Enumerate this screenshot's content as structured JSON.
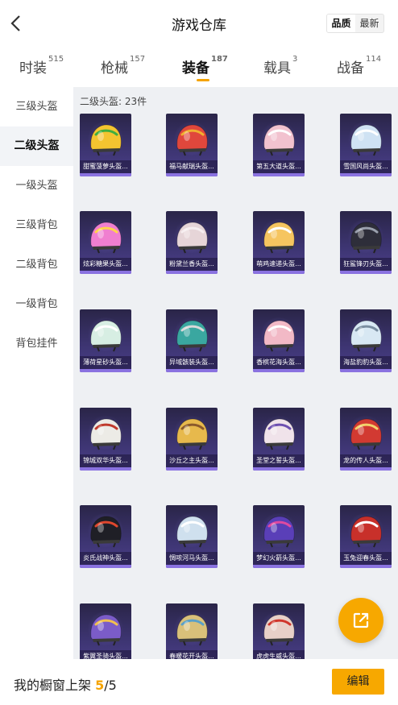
{
  "header": {
    "title": "游戏仓库",
    "sort": [
      {
        "label": "品质",
        "active": true
      },
      {
        "label": "最新",
        "active": false
      }
    ]
  },
  "tabs": [
    {
      "label": "时装",
      "count": "515",
      "active": false
    },
    {
      "label": "枪械",
      "count": "157",
      "active": false
    },
    {
      "label": "装备",
      "count": "187",
      "active": true
    },
    {
      "label": "载具",
      "count": "3",
      "active": false
    },
    {
      "label": "战备",
      "count": "114",
      "active": false
    }
  ],
  "sidebar": {
    "items": [
      {
        "label": "三级头盔",
        "active": false
      },
      {
        "label": "二级头盔",
        "active": true
      },
      {
        "label": "一级头盔",
        "active": false
      },
      {
        "label": "三级背包",
        "active": false
      },
      {
        "label": "二级背包",
        "active": false
      },
      {
        "label": "一级背包",
        "active": false
      },
      {
        "label": "背包挂件",
        "active": false
      }
    ]
  },
  "content": {
    "count_label": "二级头盔: 23件",
    "items": [
      {
        "name": "甜蜜菠萝头盔...",
        "color": "#f4c430",
        "accent": "#3fae3f",
        "icon": "pineapple-helmet-icon"
      },
      {
        "name": "福马献瑞头盔...",
        "color": "#e0473c",
        "accent": "#f0b030",
        "icon": "red-helmet-icon"
      },
      {
        "name": "第五大道头盔...",
        "color": "#f2c2cf",
        "accent": "#ffffff",
        "icon": "pink-helmet-icon"
      },
      {
        "name": "雪国风尚头盔...",
        "color": "#cfe2f3",
        "accent": "#ffffff",
        "icon": "snow-helmet-icon"
      },
      {
        "name": "炫彩糖果头盔...",
        "color": "#f07fd0",
        "accent": "#ffd54a",
        "icon": "candy-helmet-icon"
      },
      {
        "name": "粉黛兰香头盔...",
        "color": "#e6d5d8",
        "accent": "#f6eef0",
        "icon": "white-helmet-icon"
      },
      {
        "name": "萌鸡速递头盔...",
        "color": "#f6c560",
        "accent": "#ffffff",
        "icon": "chick-helmet-icon"
      },
      {
        "name": "狂鲨锋刃头盔...",
        "color": "#2e2e3a",
        "accent": "#9aa0ad",
        "icon": "shark-helmet-icon"
      },
      {
        "name": "薄荷星砂头盔...",
        "color": "#d7eee3",
        "accent": "#ffffff",
        "icon": "mint-helmet-icon"
      },
      {
        "name": "异域骸装头盔...",
        "color": "#3aa7a0",
        "accent": "#d9d9d9",
        "icon": "teal-helmet-icon"
      },
      {
        "name": "香槟花海头盔...",
        "color": "#f2b9c6",
        "accent": "#ffffff",
        "icon": "flower-helmet-icon"
      },
      {
        "name": "海盐豹豹头盔...",
        "color": "#d8e8f3",
        "accent": "#7a8ea0",
        "icon": "leopard-helmet-icon"
      },
      {
        "name": "锦城双华头盔...",
        "color": "#ecebe6",
        "accent": "#c0392b",
        "icon": "jin-helmet-icon"
      },
      {
        "name": "沙丘之主头盔...",
        "color": "#e7b94c",
        "accent": "#8b5a2b",
        "icon": "dune-helmet-icon"
      },
      {
        "name": "圣堂之誓头盔...",
        "color": "#f0e3ea",
        "accent": "#6d4fb0",
        "icon": "temple-helmet-icon"
      },
      {
        "name": "龙的传人头盔...",
        "color": "#d23a32",
        "accent": "#f2d16b",
        "icon": "dragon-helmet-icon"
      },
      {
        "name": "炎氏战神头盔...",
        "color": "#1f1f26",
        "accent": "#e0472e",
        "icon": "flame-helmet-icon"
      },
      {
        "name": "惆哝河马头盔...",
        "color": "#cfe0ee",
        "accent": "#ffffff",
        "icon": "hippo-helmet-icon"
      },
      {
        "name": "梦幻火箭头盔...",
        "color": "#5a3fb8",
        "accent": "#e04aa0",
        "icon": "rocket-helmet-icon"
      },
      {
        "name": "玉兔迎春头盔...",
        "color": "#c8302a",
        "accent": "#ffffff",
        "icon": "rabbit-helmet-icon"
      },
      {
        "name": "紫翼圣骑头盔...",
        "color": "#7b5cc8",
        "accent": "#f2c14e",
        "icon": "knight-helmet-icon"
      },
      {
        "name": "春暖花开头盔...",
        "color": "#d9c07a",
        "accent": "#5aa0c8",
        "icon": "spring-helmet-icon"
      },
      {
        "name": "虎虎生威头盔...",
        "color": "#e8d0c8",
        "accent": "#d0362c",
        "icon": "tiger-helmet-icon"
      }
    ]
  },
  "footer": {
    "label": "我的橱窗上架",
    "current": "5",
    "separator": "/",
    "total": "5",
    "edit_label": "编辑"
  },
  "colors": {
    "accent": "#f7a800",
    "card_bg": "#3c3470",
    "active_tab_text": "#111111"
  }
}
